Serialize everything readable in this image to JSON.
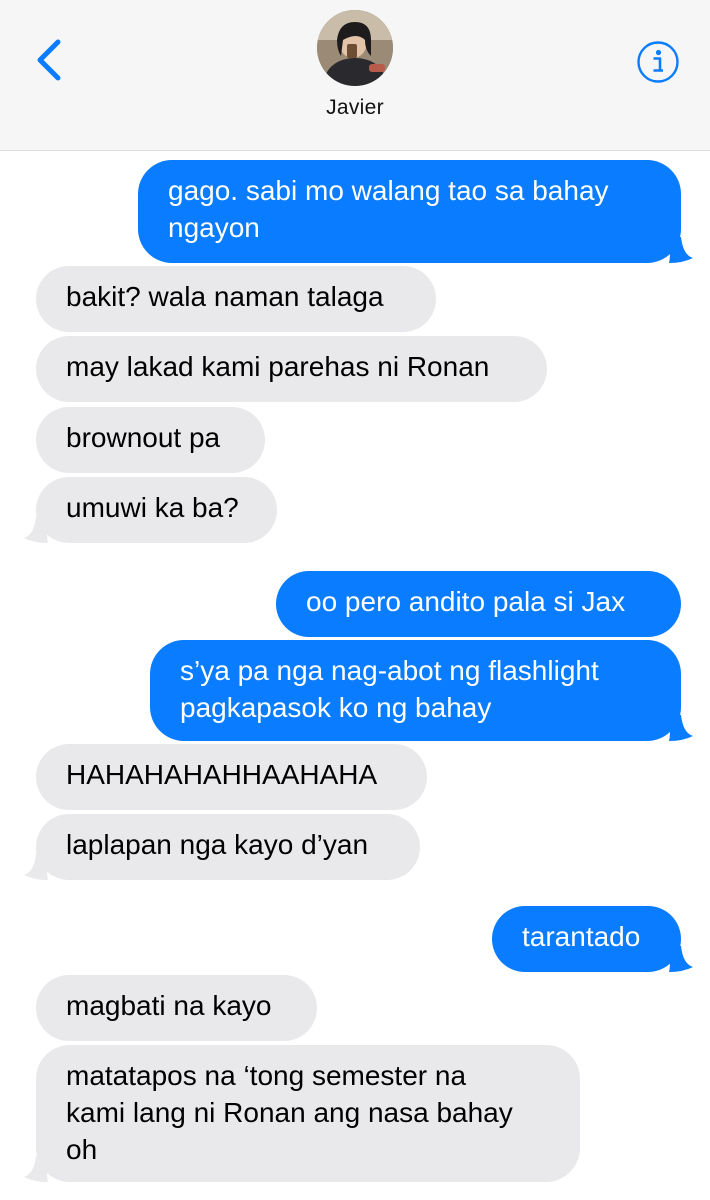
{
  "header": {
    "contact_name": "Javier",
    "back_icon": "chevron-left-icon",
    "info_icon": "info-circle-icon",
    "accent_color": "#0a7cff"
  },
  "messages": [
    {
      "direction": "outgoing",
      "lines": [
        "gago. sabi mo walang tao sa bahay",
        "ngayon"
      ]
    },
    {
      "direction": "incoming",
      "lines": [
        "bakit? wala naman talaga"
      ]
    },
    {
      "direction": "incoming",
      "lines": [
        "may lakad kami parehas ni Ronan"
      ]
    },
    {
      "direction": "incoming",
      "lines": [
        "brownout pa"
      ]
    },
    {
      "direction": "incoming",
      "lines": [
        "umuwi ka ba?"
      ]
    },
    {
      "direction": "outgoing",
      "lines": [
        "oo pero andito pala si Jax"
      ]
    },
    {
      "direction": "outgoing",
      "lines": [
        "s’ya pa nga nag-abot ng flashlight",
        "pagkapasok ko ng bahay"
      ]
    },
    {
      "direction": "incoming",
      "lines": [
        "HAHAHAHAHHAAHAHA"
      ]
    },
    {
      "direction": "incoming",
      "lines": [
        "laplapan nga kayo d’yan"
      ]
    },
    {
      "direction": "outgoing",
      "lines": [
        "tarantado"
      ]
    },
    {
      "direction": "incoming",
      "lines": [
        "magbati na kayo"
      ]
    },
    {
      "direction": "incoming",
      "lines": [
        "matatapos na ‘tong semester na",
        "kami lang ni Ronan ang nasa bahay",
        "oh"
      ]
    }
  ]
}
